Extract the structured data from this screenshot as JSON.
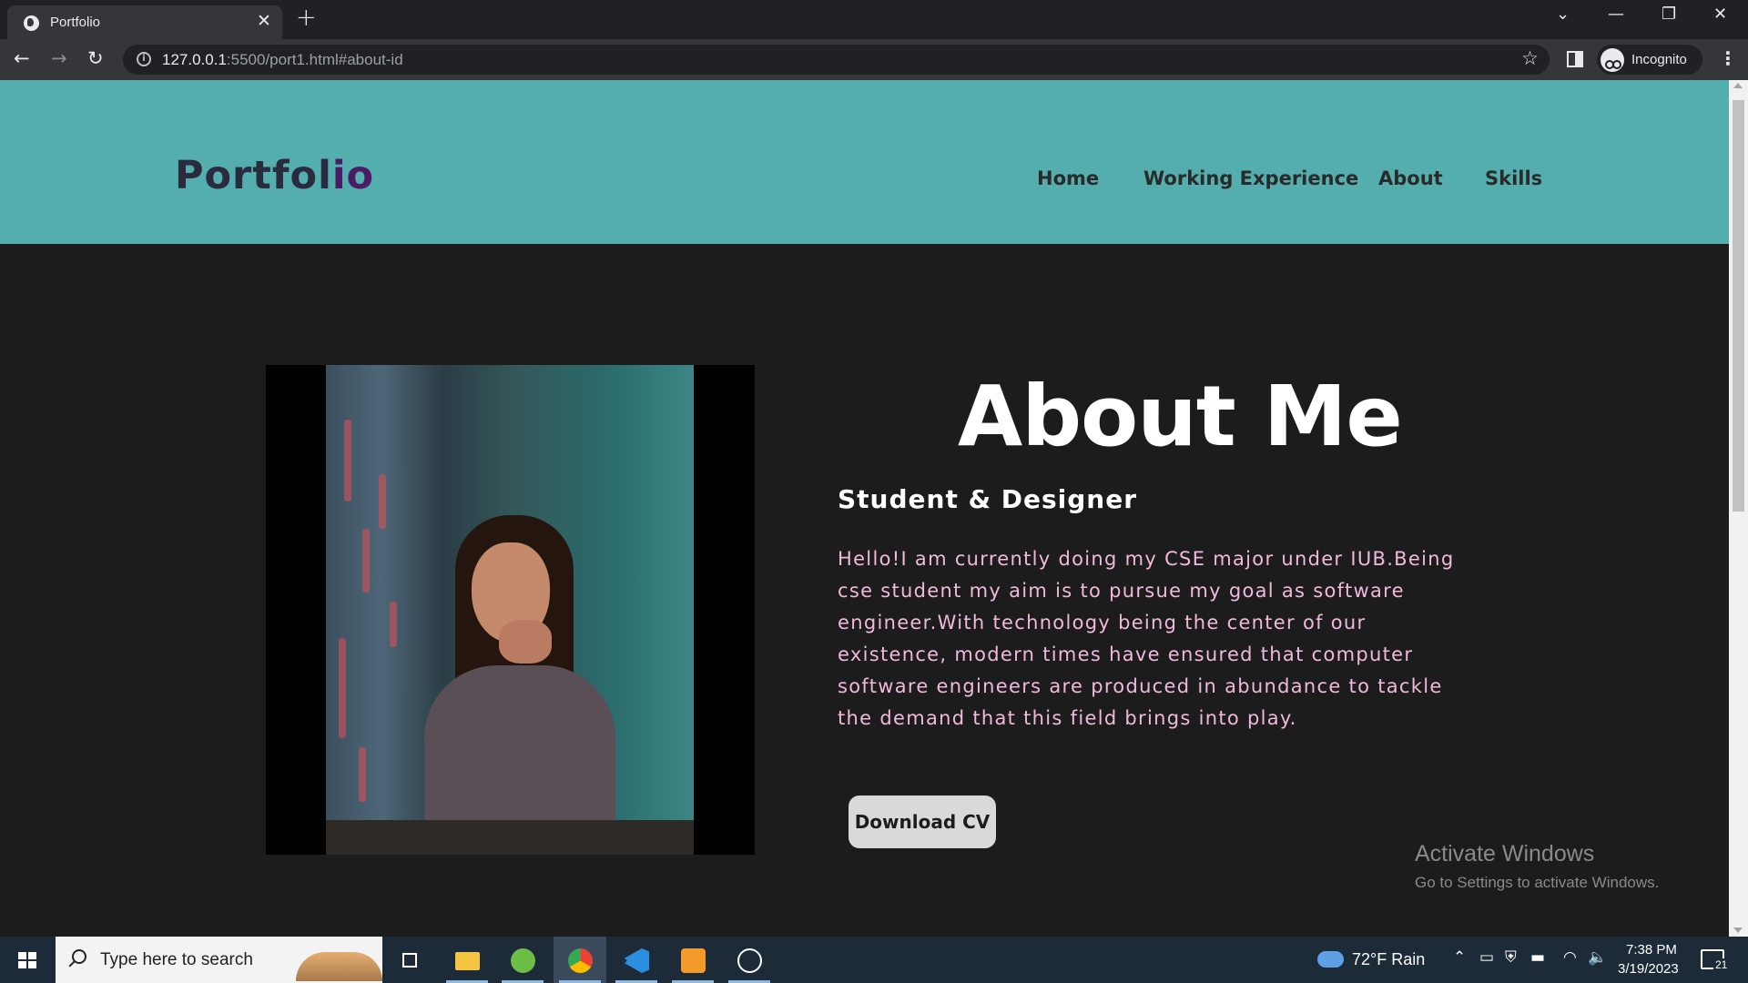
{
  "browser": {
    "tab_title": "Portfolio",
    "tab_close": "✕",
    "new_tab": "+",
    "url_host": "127.0.0.1",
    "url_rest": ":5500/port1.html#about-id",
    "profile_label": "Incognito"
  },
  "site": {
    "logo_first": "Portfol",
    "logo_last": "io",
    "nav": [
      "Home",
      "Working Experience",
      "About",
      "Skills"
    ],
    "about_heading": "About Me",
    "about_subheading": "Student & Designer",
    "about_text": "Hello!I am currently doing my CSE major under IUB.Being cse student my aim is to pursue my goal as software engineer.With technology being the center of our existence, modern times have ensured that computer software engineers are produced in abundance to tackle the demand that this field brings into play.",
    "download_button": "Download CV"
  },
  "watermark": {
    "title": "Activate Windows",
    "subtitle": "Go to Settings to activate Windows."
  },
  "taskbar": {
    "search_placeholder": "Type here to search",
    "weather": "72°F  Rain",
    "time": "7:38 PM",
    "date": "3/19/2023",
    "notification_count": "21",
    "pinned_apps": [
      "task-view",
      "file-explorer",
      "utorrent",
      "chrome",
      "vscode",
      "sublime-text",
      "media-player"
    ]
  },
  "colors": {
    "header_bg": "#55aeae",
    "page_bg": "#1c1c1c",
    "about_text": "#f0b9db",
    "logo_accent": "#4b1c66"
  }
}
